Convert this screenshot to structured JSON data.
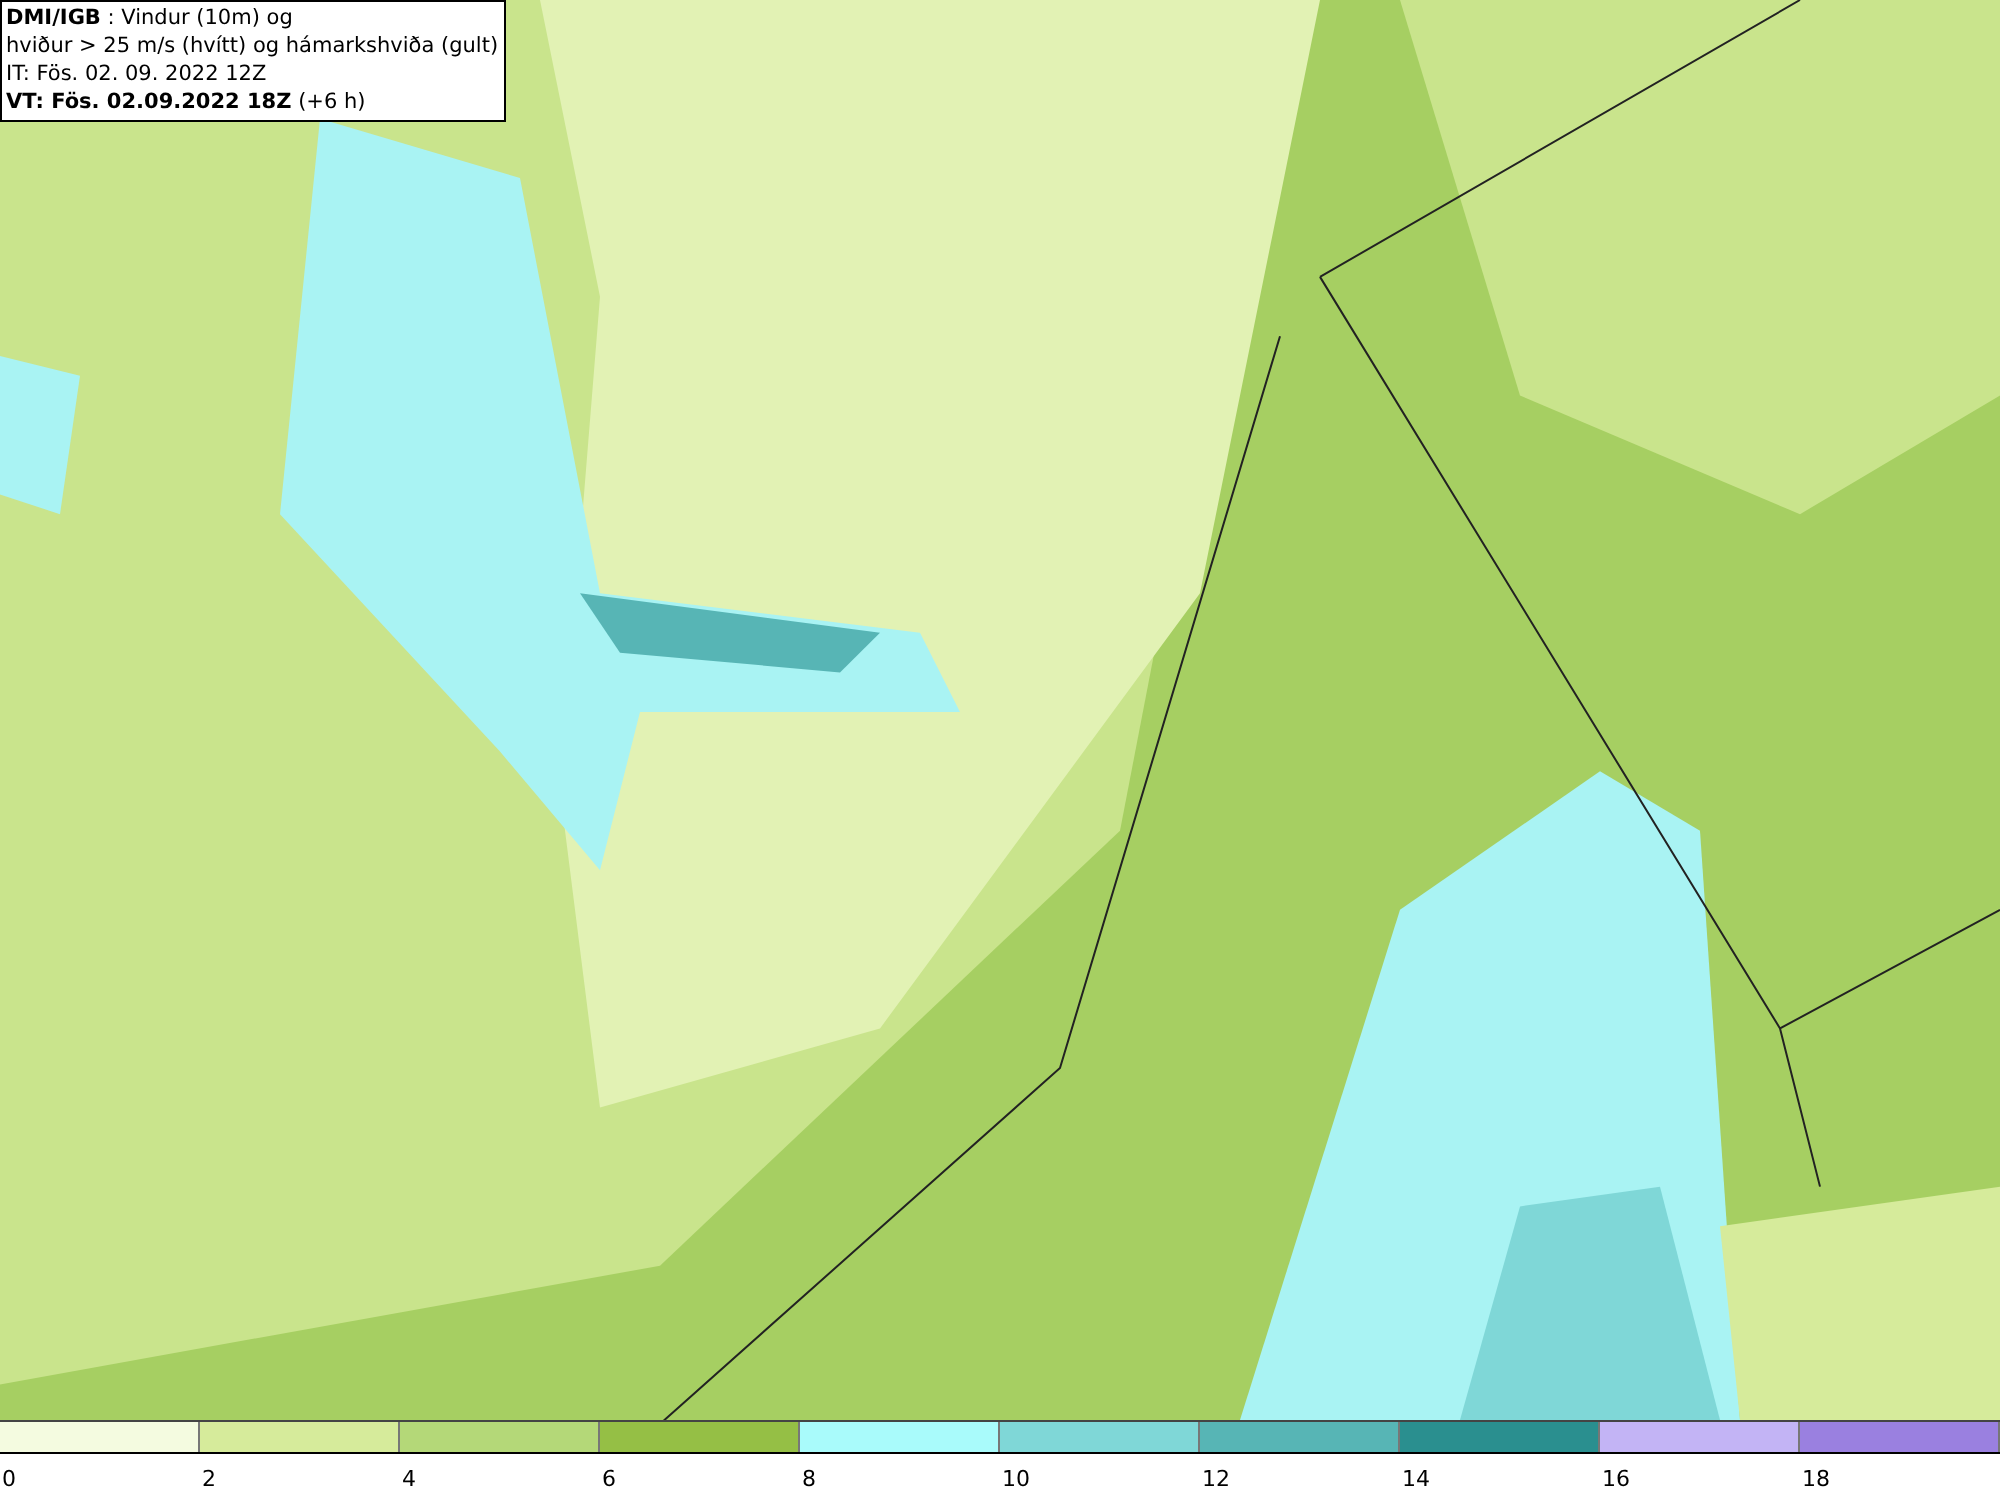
{
  "legend": {
    "lines": [
      "**DMI/IGB** : Vindur (10m) og",
      "hviður > 25 m/s (hvítt) og hámarkshviða (gult)",
      "IT: Fös. 02. 09. 2022 12Z",
      "**VT: Fös. 02.09.2022 18Z** (+6 h)"
    ]
  },
  "colorbar": [
    {
      "label": "0",
      "color": "#f4fbe0"
    },
    {
      "label": "2",
      "color": "#d6eb9b"
    },
    {
      "label": "4",
      "color": "#b4d878"
    },
    {
      "label": "6",
      "color": "#95bf45"
    },
    {
      "label": "8",
      "color": "#a9fbfb"
    },
    {
      "label": "10",
      "color": "#7fd7d7"
    },
    {
      "label": "12",
      "color": "#57b5b5"
    },
    {
      "label": "14",
      "color": "#2a8f8f"
    },
    {
      "label": "16",
      "color": "#c3b4f5"
    },
    {
      "label": "18",
      "color": "#9a80e0"
    }
  ]
}
